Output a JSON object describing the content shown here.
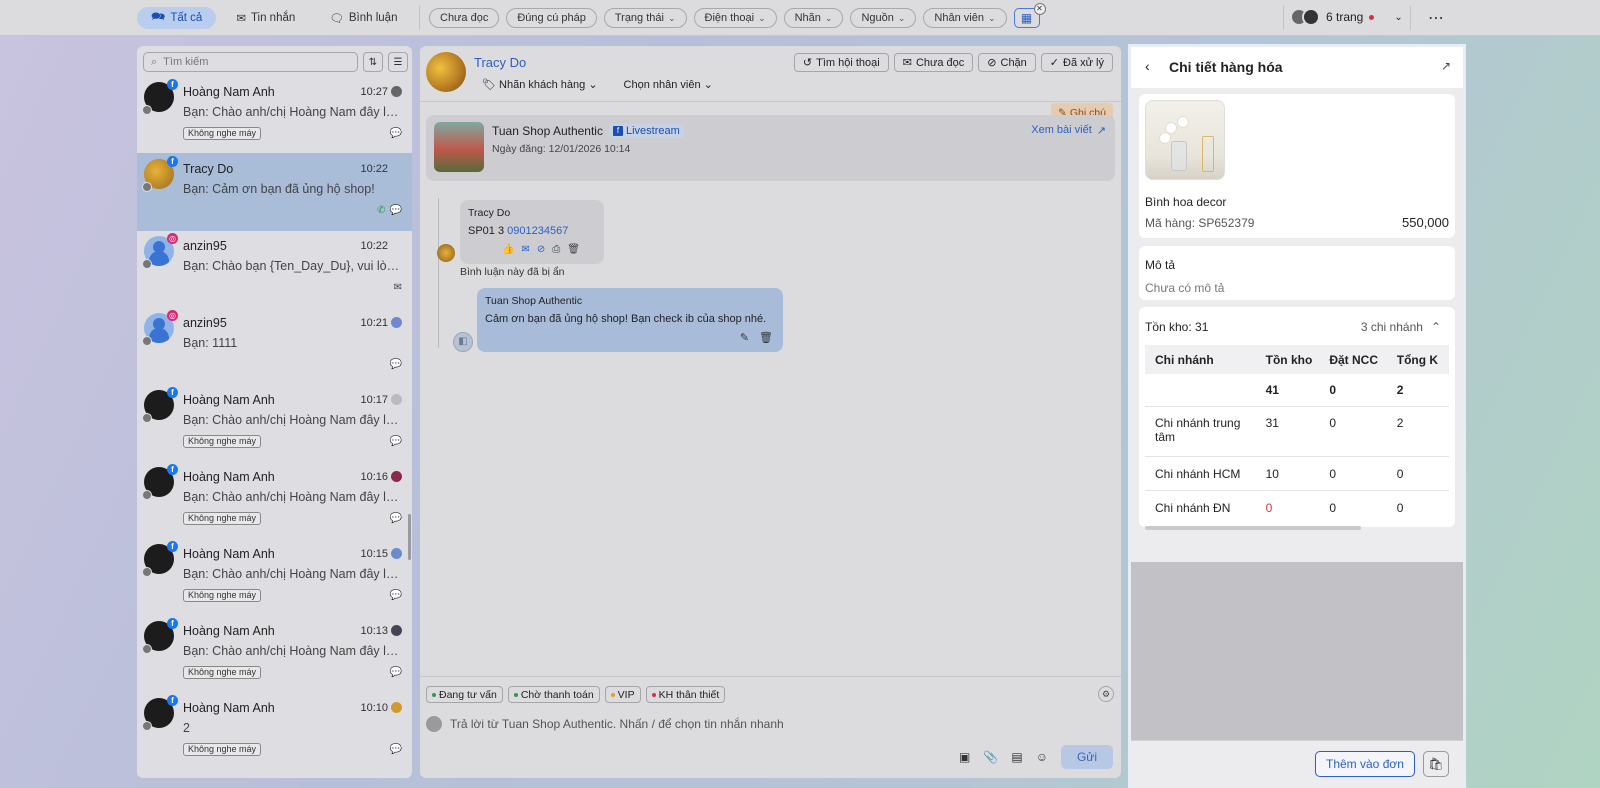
{
  "topbar": {
    "tabs": [
      {
        "label": "Tất cả",
        "icon": "chat-bubbles-icon",
        "active": true
      },
      {
        "label": "Tin nhắn",
        "icon": "envelope-icon",
        "active": false
      },
      {
        "label": "Bình luận",
        "icon": "comment-icon",
        "active": false
      }
    ],
    "filters": [
      {
        "label": "Chưa đọc",
        "dropdown": false
      },
      {
        "label": "Đúng cú pháp",
        "dropdown": false
      },
      {
        "label": "Trạng thái",
        "dropdown": true
      },
      {
        "label": "Điện thoại",
        "dropdown": true
      },
      {
        "label": "Nhãn",
        "dropdown": true
      },
      {
        "label": "Nguồn",
        "dropdown": true
      },
      {
        "label": "Nhân viên",
        "dropdown": true
      }
    ],
    "account_label": "6 trang"
  },
  "sidebar": {
    "search_placeholder": "Tìm kiếm",
    "conversations": [
      {
        "name": "Hoàng Nam Anh",
        "time": "10:27",
        "preview": "Bạn: Chào anh/chị Hoàng Nam đây là...",
        "tag": "Không nghe máy",
        "channel": "fb"
      },
      {
        "name": "Tracy Do",
        "time": "10:22",
        "preview": "Bạn: Cảm ơn bạn đã ủng hộ shop!",
        "tag": "",
        "channel": "fb"
      },
      {
        "name": "anzin95",
        "time": "10:22",
        "preview": "Bạn: Chào bạn {Ten_Day_Du}, vui lòn...",
        "tag": "",
        "channel": "ig"
      },
      {
        "name": "anzin95",
        "time": "10:21",
        "preview": "Bạn: 1111",
        "tag": "",
        "channel": "ig"
      },
      {
        "name": "Hoàng Nam Anh",
        "time": "10:17",
        "preview": "Bạn: Chào anh/chị Hoàng Nam đây là...",
        "tag": "Không nghe máy",
        "channel": "fb"
      },
      {
        "name": "Hoàng Nam Anh",
        "time": "10:16",
        "preview": "Bạn: Chào anh/chị Hoàng Nam đây là...",
        "tag": "Không nghe máy",
        "channel": "fb"
      },
      {
        "name": "Hoàng Nam Anh",
        "time": "10:15",
        "preview": "Bạn: Chào anh/chị Hoàng Nam đây là...",
        "tag": "Không nghe máy",
        "channel": "fb"
      },
      {
        "name": "Hoàng Nam Anh",
        "time": "10:13",
        "preview": "Bạn: Chào anh/chị Hoàng Nam đây là...",
        "tag": "Không nghe máy",
        "channel": "fb"
      },
      {
        "name": "Hoàng Nam Anh",
        "time": "10:10",
        "preview": "2",
        "tag": "Không nghe máy",
        "channel": "fb"
      }
    ]
  },
  "chat": {
    "customer_name": "Tracy Do",
    "label_dropdown": "Nhãn khách hàng",
    "staff_dropdown": "Chọn nhân viên",
    "actions": [
      "Tìm hội thoại",
      "Chưa đọc",
      "Chặn",
      "Đã xử lý"
    ],
    "note_button": "Ghi chú",
    "post": {
      "shop": "Tuan Shop Authentic",
      "badge": "Livestream",
      "date": "Ngày đăng: 12/01/2026 10:14",
      "view_post": "Xem bài viết"
    },
    "comment": {
      "author": "Tracy Do",
      "text_prefix": "SP01 3",
      "phone": "0901234567",
      "hidden_note": "Bình luận này đã bị ẩn"
    },
    "reply": {
      "author": "Tuan Shop Authentic",
      "text": "Cảm ơn bạn đã ủng hộ shop! Bạn check ib của shop nhé."
    },
    "composer": {
      "tags": [
        {
          "label": "Đang tư vấn",
          "color": "#2e9a45"
        },
        {
          "label": "Chờ thanh toán",
          "color": "#2e9a45"
        },
        {
          "label": "VIP",
          "color": "#e0a020"
        },
        {
          "label": "KH thân thiết",
          "color": "#d83040"
        }
      ],
      "placeholder": "Trả lời từ Tuan Shop Authentic. Nhấn / để chọn tin nhắn nhanh",
      "send_label": "Gửi"
    }
  },
  "product": {
    "panel_title": "Chi tiết hàng hóa",
    "name": "Bình hoa decor",
    "code": "Mã hàng: SP652379",
    "price": "550,000",
    "desc_label": "Mô tả",
    "desc_value": "Chưa có mô tả",
    "stock_label": "Tồn kho: 31",
    "branches_label": "3 chi nhánh",
    "table": {
      "headers": [
        "Chi nhánh",
        "Tồn kho",
        "Đặt NCC",
        "Tổng K"
      ],
      "total": [
        "",
        "41",
        "0",
        "2"
      ],
      "rows": [
        [
          "Chi nhánh trung tâm",
          "31",
          "0",
          "2"
        ],
        [
          "Chi nhánh HCM",
          "10",
          "0",
          "0"
        ],
        [
          "Chi nhánh ĐN",
          "0",
          "0",
          "0"
        ]
      ]
    },
    "add_button": "Thêm vào đơn"
  }
}
